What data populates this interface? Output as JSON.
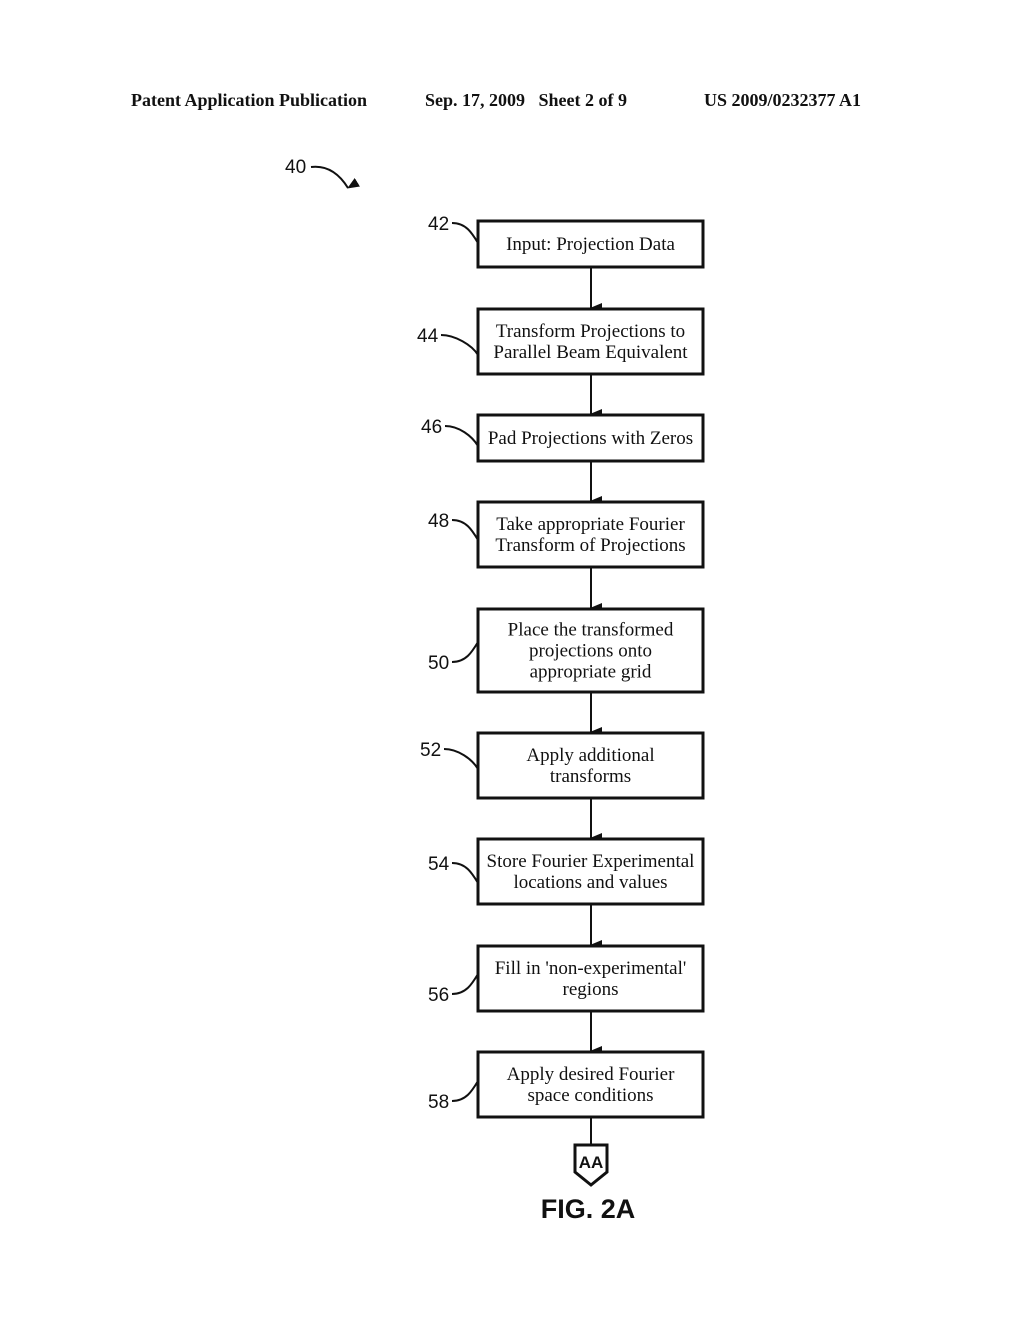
{
  "header": {
    "left": "Patent Application Publication",
    "middle": "Sep. 17, 2009   Sheet 2 of 9",
    "right": "US 2009/0232377 A1"
  },
  "figure": {
    "ref": "40",
    "caption": "FIG. 2A",
    "connector_label": "AA",
    "steps": [
      {
        "ref": "42",
        "lines": [
          "Input: Projection Data"
        ]
      },
      {
        "ref": "44",
        "lines": [
          "Transform Projections to",
          "Parallel Beam Equivalent"
        ]
      },
      {
        "ref": "46",
        "lines": [
          "Pad Projections with Zeros"
        ]
      },
      {
        "ref": "48",
        "lines": [
          "Take appropriate Fourier",
          "Transform of Projections"
        ]
      },
      {
        "ref": "50",
        "lines": [
          "Place the transformed",
          "projections onto",
          "appropriate grid"
        ]
      },
      {
        "ref": "52",
        "lines": [
          "Apply additional",
          "transforms"
        ]
      },
      {
        "ref": "54",
        "lines": [
          "Store Fourier Experimental",
          "locations and values"
        ]
      },
      {
        "ref": "56",
        "lines": [
          "Fill in 'non-experimental'",
          "regions"
        ]
      },
      {
        "ref": "58",
        "lines": [
          "Apply desired Fourier",
          "space conditions"
        ]
      }
    ]
  }
}
